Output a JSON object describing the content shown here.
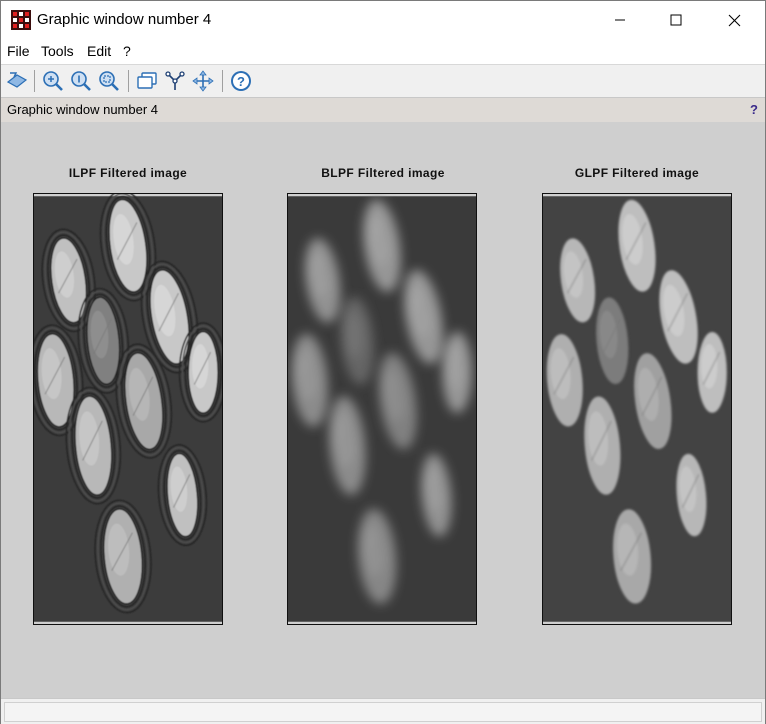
{
  "window": {
    "title": "Graphic window number 4",
    "controls": [
      "minimize",
      "maximize",
      "close"
    ]
  },
  "menu": {
    "items": [
      {
        "label": "File"
      },
      {
        "label": "Tools"
      },
      {
        "label": "Edit"
      },
      {
        "label": "?"
      }
    ]
  },
  "toolbar": {
    "buttons": [
      {
        "icon": "rotate-icon"
      },
      {
        "icon": "zoom-in-icon"
      },
      {
        "icon": "zoom-original-icon"
      },
      {
        "icon": "zoom-area-icon"
      },
      {
        "icon": "datatip-icon"
      },
      {
        "icon": "datatip-editor-icon"
      },
      {
        "icon": "pan-icon"
      },
      {
        "icon": "help-icon"
      }
    ]
  },
  "infobar": {
    "text": "Graphic window number 4",
    "help_mark": "?"
  },
  "plots": [
    {
      "title": "ILPF Filtered image",
      "style": "ringing"
    },
    {
      "title": "BLPF Filtered image",
      "style": "blurred"
    },
    {
      "title": "GLPF Filtered image",
      "style": "smooth"
    }
  ],
  "colors": {
    "canvas": "#cfcfcf",
    "infobar": "#dedad6",
    "toolbar": "#f0f0f0",
    "icon_blue": "#2c6fb5"
  }
}
